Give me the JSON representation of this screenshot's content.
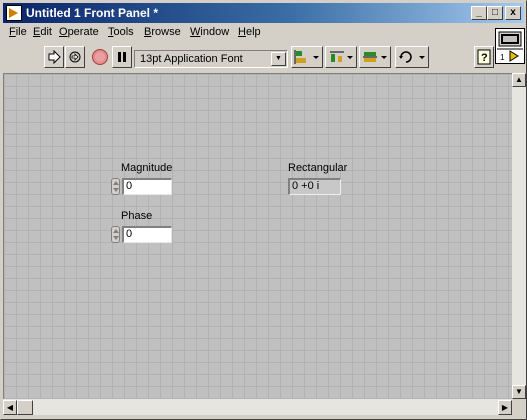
{
  "window": {
    "title": "Untitled 1 Front Panel *",
    "minimize": "_",
    "maximize": "□",
    "close": "x"
  },
  "menubar": {
    "items": [
      {
        "label": "File",
        "hotkey": "F"
      },
      {
        "label": "Edit",
        "hotkey": "E"
      },
      {
        "label": "Operate",
        "hotkey": "O"
      },
      {
        "label": "Tools",
        "hotkey": "T"
      },
      {
        "label": "Browse",
        "hotkey": "B"
      },
      {
        "label": "Window",
        "hotkey": "W"
      },
      {
        "label": "Help",
        "hotkey": "H"
      }
    ]
  },
  "toolbar": {
    "font": "13pt Application Font",
    "buttons": [
      "run-icon",
      "run-continuously-icon",
      "abort-icon",
      "pause-icon",
      "align-icon",
      "distribute-icon",
      "resize-icon",
      "reorder-icon",
      "help-icon"
    ]
  },
  "panel": {
    "magnitude": {
      "label": "Magnitude",
      "value": "0"
    },
    "phase": {
      "label": "Phase",
      "value": "0"
    },
    "rectangular": {
      "label": "Rectangular",
      "value": "0 +0 i"
    }
  },
  "colors": {
    "titlebar_start": "#0a246a",
    "titlebar_end": "#a6caf0",
    "panel_bg": "#c0c0c0",
    "grid": "#b2b2b2"
  }
}
